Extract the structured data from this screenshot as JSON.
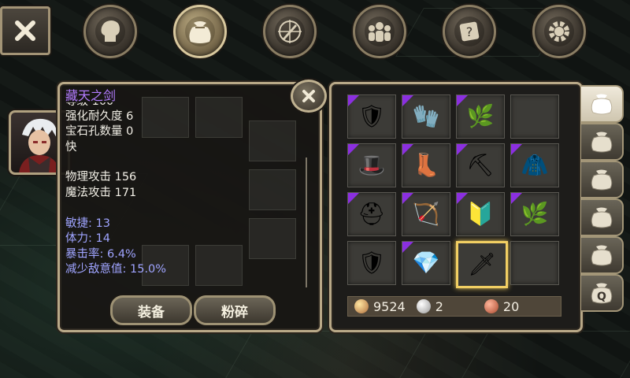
{
  "topbar": {
    "close_icon": "close-x-icon",
    "buttons": [
      {
        "name": "character",
        "icon": "head-silhouette-icon",
        "active": false
      },
      {
        "name": "inventory",
        "icon": "bag-icon",
        "active": true
      },
      {
        "name": "skills",
        "icon": "compass-sword-icon",
        "active": false
      },
      {
        "name": "social",
        "icon": "people-icon",
        "active": false
      },
      {
        "name": "quests",
        "icon": "scroll-question-icon",
        "active": false
      },
      {
        "name": "settings",
        "icon": "gear-icon",
        "active": false
      }
    ]
  },
  "item_detail": {
    "name": "藏天之剑",
    "cut_line": "等级 100",
    "lines": [
      "强化耐久度 6",
      "宝石孔数量 0",
      "快"
    ],
    "attack": [
      "物理攻击 156",
      "魔法攻击 171"
    ],
    "bonus": [
      "敏捷: 13",
      "体力: 14",
      "暴击率: 6.4%",
      "减少敌意值: 15.0%"
    ],
    "equip_label": "装备",
    "smash_label": "粉碎"
  },
  "inventory": {
    "slots": [
      {
        "icon": "bronze-armor-icon",
        "glyph": "🛡",
        "rare": true
      },
      {
        "icon": "gold-gauntlet-icon",
        "glyph": "🧤",
        "rare": true
      },
      {
        "icon": "green-herb-icon",
        "glyph": "🌿",
        "rare": true
      },
      {
        "icon": "empty-slot",
        "glyph": "",
        "rare": false
      },
      {
        "icon": "blue-hat-icon",
        "glyph": "🎩",
        "rare": true
      },
      {
        "icon": "leather-boots-icon",
        "glyph": "👢",
        "rare": true
      },
      {
        "icon": "purple-scythe-icon",
        "glyph": "⛏",
        "rare": true
      },
      {
        "icon": "red-robe-icon",
        "glyph": "🧥",
        "rare": true
      },
      {
        "icon": "winged-helmet-icon",
        "glyph": "⛑",
        "rare": true
      },
      {
        "icon": "red-bow-icon",
        "glyph": "🏹",
        "rare": true
      },
      {
        "icon": "blue-crest-icon",
        "glyph": "🔰",
        "rare": true
      },
      {
        "icon": "green-herb-icon",
        "glyph": "🌿",
        "rare": true
      },
      {
        "icon": "silver-chest-armor-icon",
        "glyph": "🛡",
        "rare": false
      },
      {
        "icon": "blue-gem-icon",
        "glyph": "💎",
        "rare": true
      },
      {
        "icon": "dark-sword-icon",
        "glyph": "🗡",
        "rare": false,
        "selected": true
      },
      {
        "icon": "empty-slot",
        "glyph": "",
        "rare": false
      }
    ],
    "currency": {
      "gold": "9524",
      "silver": "2",
      "copper": "20"
    }
  },
  "bag_tabs": [
    {
      "label": "",
      "icon": "bag-icon",
      "active": true
    },
    {
      "label": "",
      "icon": "bag-icon",
      "active": false
    },
    {
      "label": "",
      "icon": "bag-icon",
      "active": false
    },
    {
      "label": "",
      "icon": "bag-icon",
      "active": false
    },
    {
      "label": "",
      "icon": "bag-icon",
      "active": false
    },
    {
      "label": "Q",
      "icon": "quest-bag-icon",
      "active": false
    }
  ],
  "colors": {
    "accent": "#f2cf63",
    "rare": "#8b2fe0",
    "item_name": "#b37cff",
    "bonus_text": "#9fa4ff"
  }
}
